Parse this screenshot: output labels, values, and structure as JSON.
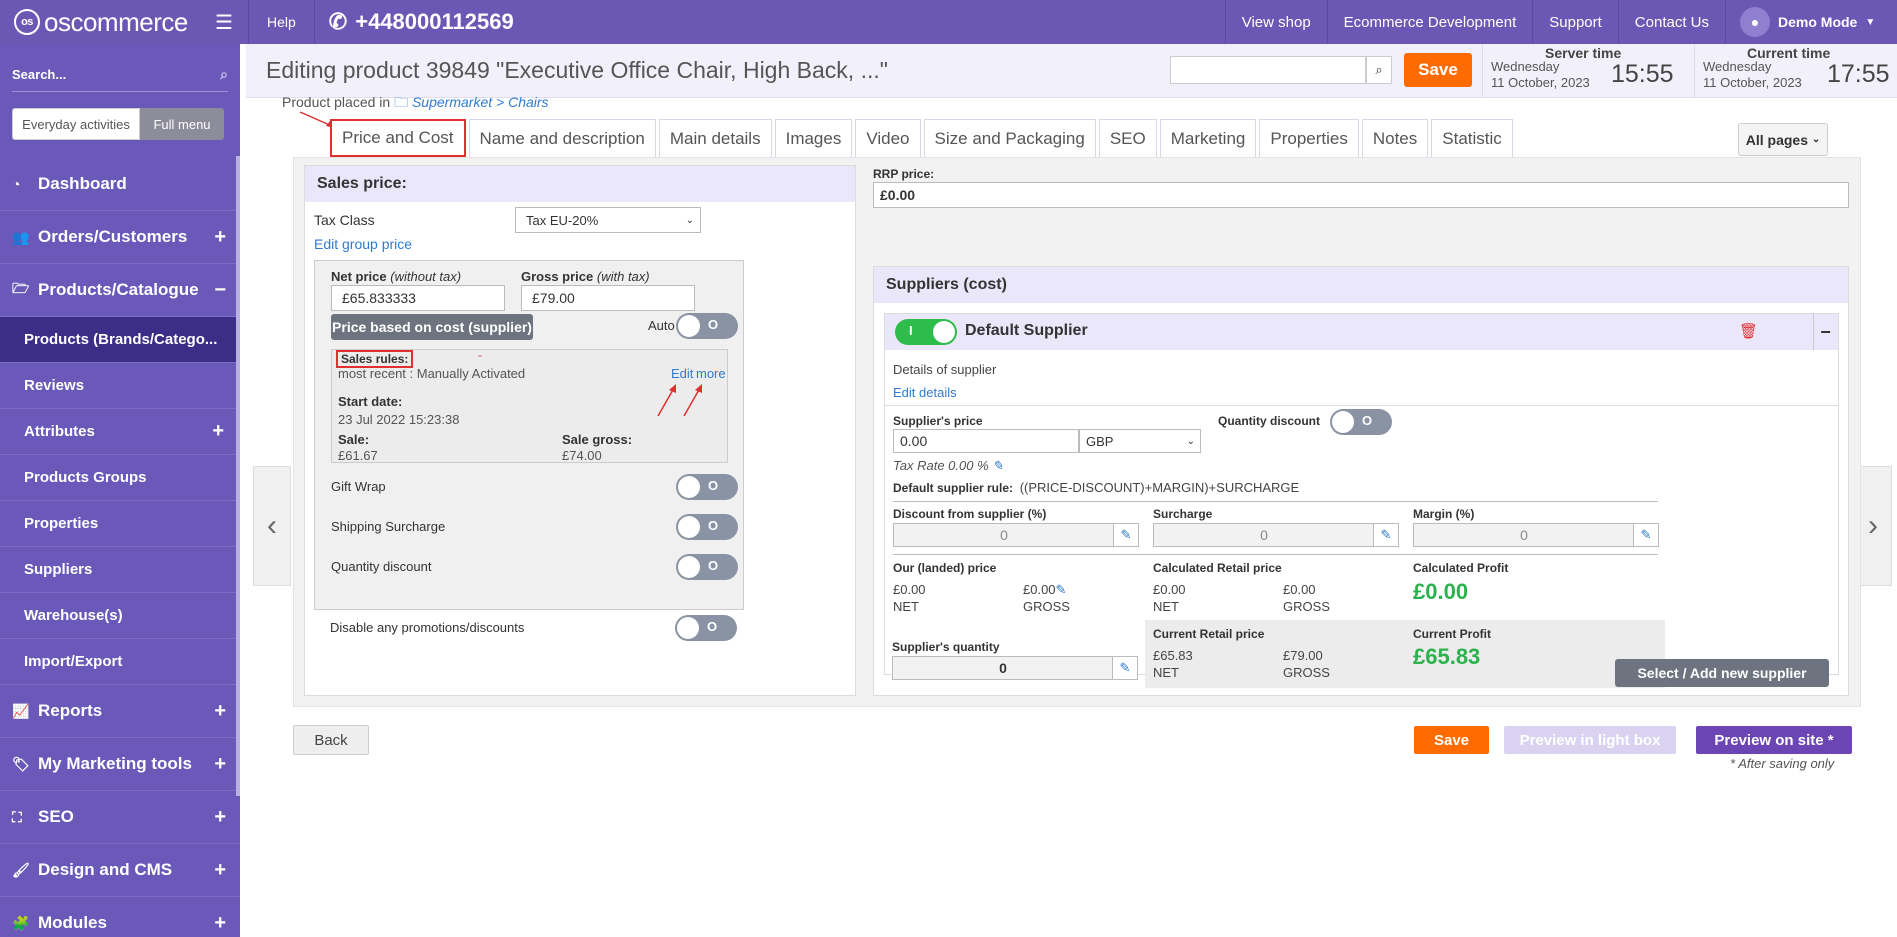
{
  "topbar": {
    "logo": "oscommerce",
    "help": "Help",
    "phone": "+448000112569",
    "links": [
      "View shop",
      "Ecommerce Development",
      "Support",
      "Contact Us"
    ],
    "user": "Demo Mode"
  },
  "sidebar": {
    "search_placeholder": "Search...",
    "mode_everyday": "Everyday activities",
    "mode_full": "Full menu",
    "items": {
      "dashboard": "Dashboard",
      "orders": "Orders/Customers",
      "products": "Products/Catalogue",
      "reports": "Reports",
      "marketing": "My Marketing tools",
      "seo": "SEO",
      "design": "Design and CMS",
      "modules": "Modules"
    },
    "subitems": [
      "Products (Brands/Catego...",
      "Reviews",
      "Attributes",
      "Products Groups",
      "Properties",
      "Suppliers",
      "Warehouse(s)",
      "Import/Export"
    ]
  },
  "header": {
    "title": "Editing product 39849 \"Executive Office Chair, High Back, ...\"",
    "save": "Save",
    "server_time_label": "Server time",
    "server_day": "Wednesday",
    "server_date": "11 October, 2023",
    "server_time": "15:55",
    "current_time_label": "Current time",
    "current_day": "Wednesday",
    "current_date": "11 October, 2023",
    "current_time": "17:55"
  },
  "breadcrumb": {
    "prefix": "Product placed in",
    "cat1": "Supermarket",
    "sep": ">",
    "cat2": "Chairs"
  },
  "tabs": [
    "Price and Cost",
    "Name and description",
    "Main details",
    "Images",
    "Video",
    "Size and Packaging",
    "SEO",
    "Marketing",
    "Properties",
    "Notes",
    "Statistic"
  ],
  "all_pages": "All pages",
  "sales": {
    "heading": "Sales price:",
    "tax_class_label": "Tax Class",
    "tax_class_value": "Tax EU-20%",
    "edit_group_price": "Edit group price",
    "net_label": "Net price",
    "net_note": "(without tax)",
    "net_value": "£65.833333",
    "gross_label": "Gross price",
    "gross_note": "(with tax)",
    "gross_value": "£79.00",
    "price_based_btn": "Price based on cost (supplier)",
    "auto_label": "Auto",
    "toggle_off": "O",
    "rules_label": "Sales rules:",
    "rules_recent": "most recent : Manually Activated",
    "edit": "Edit",
    "more": "more",
    "start_label": "Start date:",
    "start_value": "23 Jul 2022 15:23:38",
    "sale_label": "Sale:",
    "sale_value": "£61.67",
    "sale_gross_label": "Sale gross:",
    "sale_gross_value": "£74.00",
    "gift_wrap": "Gift Wrap",
    "shipping_surcharge": "Shipping Surcharge",
    "quantity_discount": "Quantity discount",
    "disable_promos": "Disable any promotions/discounts"
  },
  "rrp": {
    "label": "RRP price:",
    "value": "£0.00"
  },
  "suppliers": {
    "heading": "Suppliers (cost)",
    "name": "Default Supplier",
    "toggle_on": "I",
    "details": "Details of supplier",
    "edit_details": "Edit details",
    "price_label": "Supplier's price",
    "price_value": "0.00",
    "currency": "GBP",
    "qty_discount_label": "Quantity discount",
    "tax_rate": "Tax Rate 0.00 %",
    "rule_label": "Default supplier rule:",
    "rule_value": "((PRICE-DISCOUNT)+MARGIN)+SURCHARGE",
    "discount_label": "Discount from supplier (%)",
    "surcharge_label": "Surcharge",
    "margin_label": "Margin (%)",
    "zero": "0",
    "landed_label": "Our (landed) price",
    "landed_net": "£0.00",
    "landed_gross": "£0.00",
    "net": "NET",
    "gross": "GROSS",
    "calc_retail_label": "Calculated Retail price",
    "calc_retail_net": "£0.00",
    "calc_retail_gross": "£0.00",
    "calc_profit_label": "Calculated Profit",
    "calc_profit": "£0.00",
    "current_retail_label": "Current Retail price",
    "current_retail_net": "£65.83",
    "current_retail_gross": "£79.00",
    "current_profit_label": "Current Profit",
    "current_profit": "£65.83",
    "qty_label": "Supplier's quantity",
    "qty_value": "0",
    "select_add": "Select / Add new supplier"
  },
  "footer": {
    "back": "Back",
    "save": "Save",
    "preview_lightbox": "Preview in light box",
    "preview_site": "Preview on site *",
    "note": "* After saving only"
  }
}
